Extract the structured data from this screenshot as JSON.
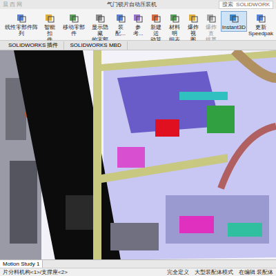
{
  "window": {
    "title": "气门锁片自动压装机",
    "watermark": "晨 西 网"
  },
  "search": {
    "label": "搜索",
    "placeholder": "SOLIDWORK"
  },
  "toolbar": [
    {
      "label": "线性零部件阵列",
      "disabled": false,
      "selected": false
    },
    {
      "label": "智能扣\n件",
      "disabled": false,
      "selected": false
    },
    {
      "label": "移动零部件",
      "disabled": false,
      "selected": false
    },
    {
      "label": "显示隐藏\n的零部件",
      "disabled": false,
      "selected": false
    },
    {
      "label": "装配...",
      "disabled": false,
      "selected": false
    },
    {
      "label": "参考...",
      "disabled": false,
      "selected": false
    },
    {
      "label": "新建运\n动算例",
      "disabled": false,
      "selected": false
    },
    {
      "label": "材料明\n细表",
      "disabled": false,
      "selected": false
    },
    {
      "label": "爆炸视\n图",
      "disabled": false,
      "selected": false
    },
    {
      "label": "爆炸直\n线草图",
      "disabled": true,
      "selected": false
    },
    {
      "label": "Instant3D",
      "disabled": false,
      "selected": true
    },
    {
      "label": "更新\nSpeedpak",
      "disabled": false,
      "selected": false
    }
  ],
  "tabs": [
    {
      "label": "SOLIDWORKS 插件",
      "selected": false
    },
    {
      "label": "SOLIDWORKS MBD",
      "selected": false
    }
  ],
  "motion_tabs": [
    {
      "label": "Motion Study 1",
      "selected": true
    }
  ],
  "status_bar": {
    "path": "片分料机构<1>/支撑座<2>",
    "items": [
      "完全定义",
      "大型装配体模式",
      "在编辑 装配体"
    ]
  }
}
